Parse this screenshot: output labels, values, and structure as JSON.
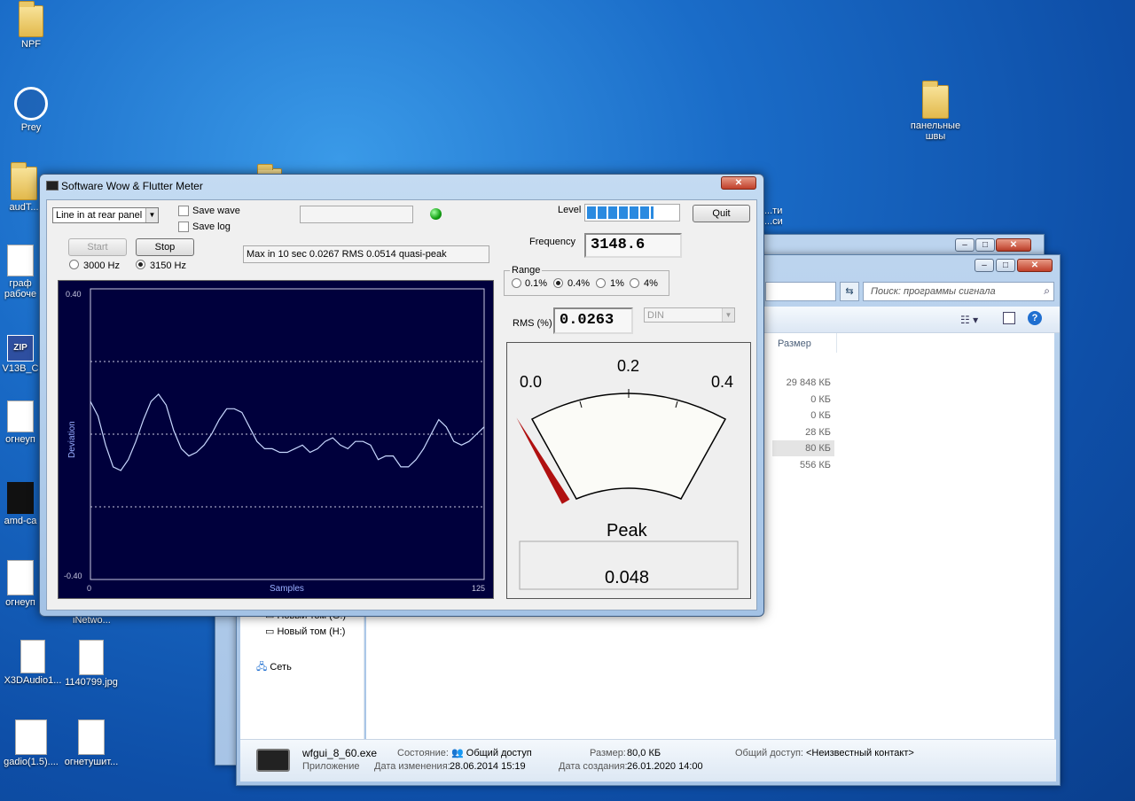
{
  "desktop": {
    "icons": [
      {
        "label": "NPF"
      },
      {
        "label": "Prey"
      },
      {
        "label": "audT..."
      },
      {
        "label": "граф\nрабоче"
      },
      {
        "label": "V13B_C"
      },
      {
        "label": "огнеуп"
      },
      {
        "label": "amd-ca"
      },
      {
        "label": "огнеуп"
      },
      {
        "label": "X3DAudio1..."
      },
      {
        "label": "1140799.jpg"
      },
      {
        "label": "gadio(1.5)...."
      },
      {
        "label": "огнетушит..."
      },
      {
        "label": "панельные\nшвы"
      },
      {
        "label": "iNetwo..."
      }
    ],
    "partial_text_right": "...ти...\n...сид"
  },
  "explorer": {
    "search_placeholder": "Поиск: программы   сигнала",
    "column_size": "Размер",
    "sizes": [
      "29 848 КБ",
      "0 КБ",
      "0 КБ",
      "28 КБ",
      "80 КБ",
      "556 КБ"
    ],
    "nav_items": [
      "Новый том (G:)",
      "Новый том (H:)",
      "Сеть"
    ],
    "details": {
      "filename": "wfgui_8_60.exe",
      "type": "Приложение",
      "state_label": "Состояние:",
      "state_value": "Общий доступ",
      "modified_label": "Дата изменения:",
      "modified_value": "28.06.2014 15:19",
      "size_label": "Размер:",
      "size_value": "80,0 КБ",
      "created_label": "Дата создания:",
      "created_value": "26.01.2020 14:00",
      "share_label": "Общий доступ:",
      "share_value": "<Неизвестный контакт>"
    }
  },
  "app": {
    "title": "Software Wow & Flutter Meter",
    "input_select": "Line in at rear panel (Blu",
    "save_wave": "Save wave",
    "save_log": "Save log",
    "start": "Start",
    "stop": "Stop",
    "freq_3000": "3000 Hz",
    "freq_3150": "3150 Hz",
    "status_text": "Max in 10 sec 0.0267 RMS 0.0514 quasi-peak",
    "level_label": "Level",
    "level_fraction": 0.72,
    "quit": "Quit",
    "frequency_label": "Frequency",
    "frequency_value": "3148.6",
    "range_label": "Range",
    "range_options": [
      "0.1%",
      "0.4%",
      "1%",
      "4%"
    ],
    "range_selected": 1,
    "rms_label": "RMS (%)",
    "rms_value": "0.0263",
    "weighting": "DIN",
    "meter": {
      "scale_labels": [
        "0.0",
        "0.2",
        "0.4"
      ],
      "title": "Peak",
      "value": "0.048",
      "needle_fraction": 0.12
    },
    "colors": {
      "plot_bg": "#00003c",
      "trace": "#c8d8ff",
      "needle": "#b01010",
      "level": "#2a8ae0"
    }
  },
  "chart_data": {
    "type": "line",
    "ylabel": "Deviation",
    "xlabel": "Samples",
    "xlim": [
      0,
      125
    ],
    "ylim": [
      -0.4,
      0.4
    ],
    "x_ticks": [
      "0",
      "125"
    ],
    "y_ticks": [
      "0.40",
      "-0.40"
    ],
    "grid": "dotted at 0.2, 0.0, -0.2",
    "series": [
      {
        "values": [
          0.09,
          0.05,
          -0.03,
          -0.09,
          -0.1,
          -0.07,
          -0.02,
          0.04,
          0.09,
          0.11,
          0.08,
          0.01,
          -0.04,
          -0.06,
          -0.05,
          -0.03,
          0.0,
          0.04,
          0.07,
          0.07,
          0.06,
          0.02,
          -0.02,
          -0.04,
          -0.04,
          -0.05,
          -0.05,
          -0.04,
          -0.03,
          -0.05,
          -0.04,
          -0.02,
          -0.01,
          -0.03,
          -0.04,
          -0.02,
          -0.02,
          -0.03,
          -0.07,
          -0.06,
          -0.06,
          -0.09,
          -0.09,
          -0.07,
          -0.04,
          0.0,
          0.04,
          0.02,
          -0.02,
          -0.03,
          -0.02,
          0.0,
          0.02
        ]
      }
    ]
  }
}
